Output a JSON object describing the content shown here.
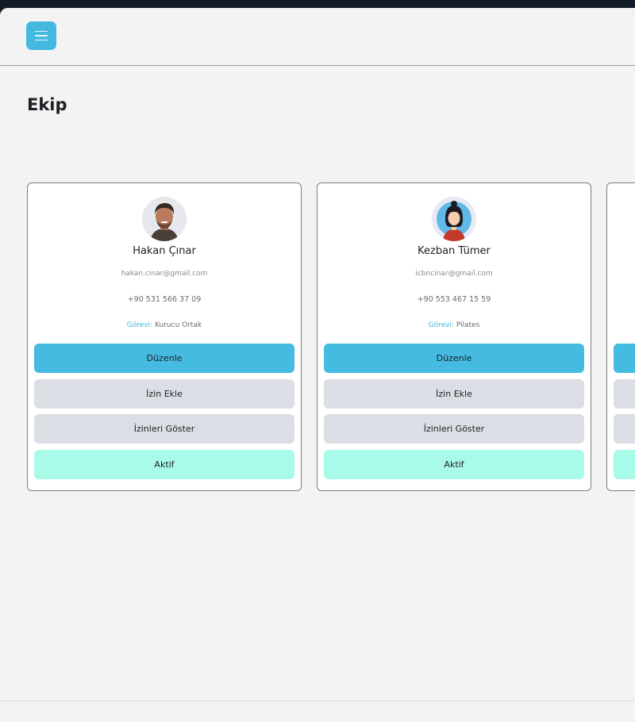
{
  "header": {
    "menu_icon": "hamburger-menu-icon",
    "accent_color": "#46bbe2"
  },
  "page": {
    "title": "Ekip"
  },
  "members": [
    {
      "name": "Hakan Çınar",
      "email": "hakan.cinar@gmail.com",
      "phone": "+90 531 566 37 09",
      "role_label": "Görevi:",
      "role": "Kurucu Ortak",
      "avatar": "man-portrait-avatar",
      "buttons": {
        "edit": "Düzenle",
        "add_leave": "İzin Ekle",
        "show_leaves": "İzinleri Göster",
        "status": "Aktif"
      }
    },
    {
      "name": "Kezban Tümer",
      "email": "icbncinar@gmail.com",
      "phone": "+90 553 467 15 59",
      "role_label": "Görevi:",
      "role": "Pilates",
      "avatar": "woman-illustration-avatar",
      "buttons": {
        "edit": "Düzenle",
        "add_leave": "İzin Ekle",
        "show_leaves": "İzinleri Göster",
        "status": "Aktif"
      }
    }
  ],
  "colors": {
    "edit_button": "#46bbe2",
    "secondary_button": "#dcdee5",
    "active_button": "#a8fbe8",
    "role_label": "#3fb4df"
  }
}
